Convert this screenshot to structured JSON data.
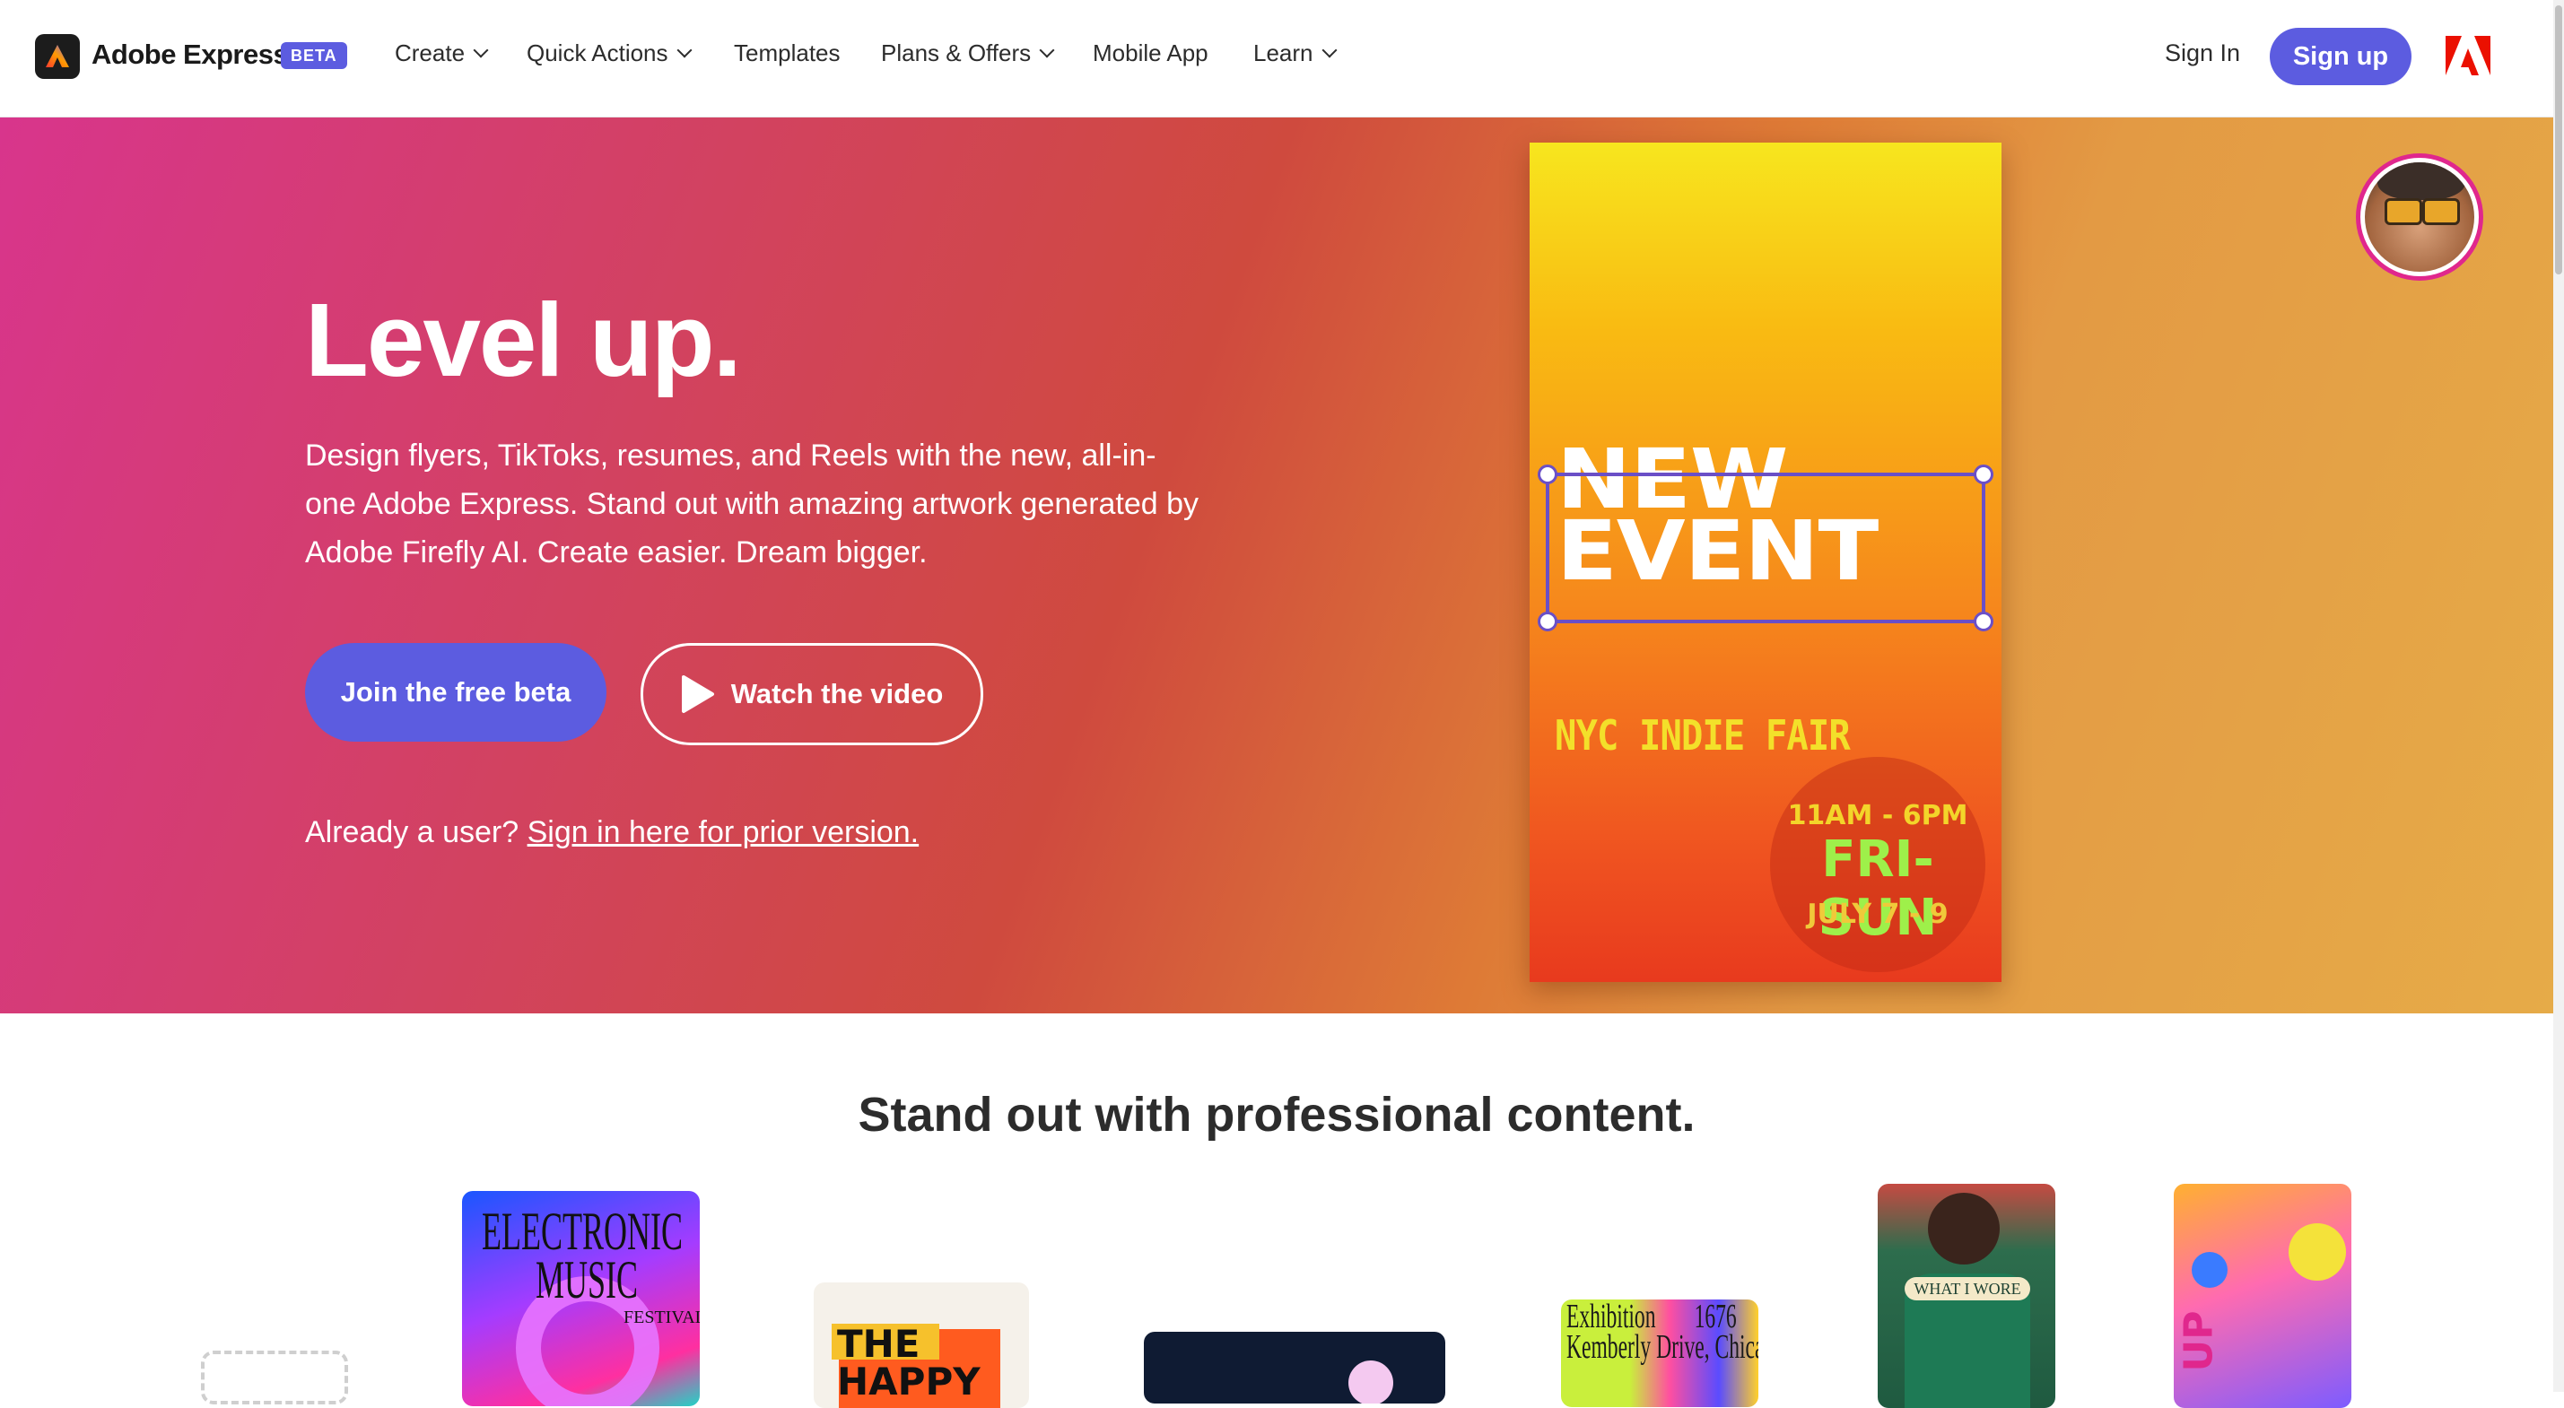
{
  "brand": {
    "name": "Adobe Express",
    "badge": "BETA"
  },
  "nav": {
    "items": [
      {
        "label": "Create",
        "has_menu": true
      },
      {
        "label": "Quick Actions",
        "has_menu": true
      },
      {
        "label": "Templates",
        "has_menu": false
      },
      {
        "label": "Plans & Offers",
        "has_menu": true
      },
      {
        "label": "Mobile App",
        "has_menu": false
      },
      {
        "label": "Learn",
        "has_menu": true
      }
    ],
    "sign_in": "Sign In",
    "sign_up": "Sign up"
  },
  "hero": {
    "title": "Level up.",
    "description": "Design flyers, TikToks, resumes, and Reels with the new, all-in-one Adobe Express. Stand out with amazing artwork generated by Adobe Firefly AI. Create easier. Dream bigger.",
    "primary_cta": "Join the free beta",
    "secondary_cta": "Watch the video",
    "already_prefix": "Already a user?",
    "already_link": "Sign in here for prior version."
  },
  "poster": {
    "headline": "NEW\nEVENT",
    "fair": "NYC INDIE FAIR",
    "time": "11AM - 6PM",
    "days": "FRI-SUN",
    "dates": "JULY 7 - 9"
  },
  "section": {
    "title": "Stand out with professional content.",
    "thumbs": [
      {
        "text_line1": "ELECTRONIC",
        "text_line2": "MUSIC",
        "text_line3": "FESTIVAL"
      },
      {
        "text": "THE HAPPY"
      },
      {
        "text": ""
      },
      {
        "text_line1": "Exhibition",
        "text_line2": "Kemberly Drive, Chica",
        "text_line3": "1676"
      },
      {
        "text": "WHAT I WORE"
      },
      {
        "text": "UP"
      }
    ]
  },
  "colors": {
    "accent": "#5c5ce0",
    "adobe_red": "#eb1000"
  }
}
